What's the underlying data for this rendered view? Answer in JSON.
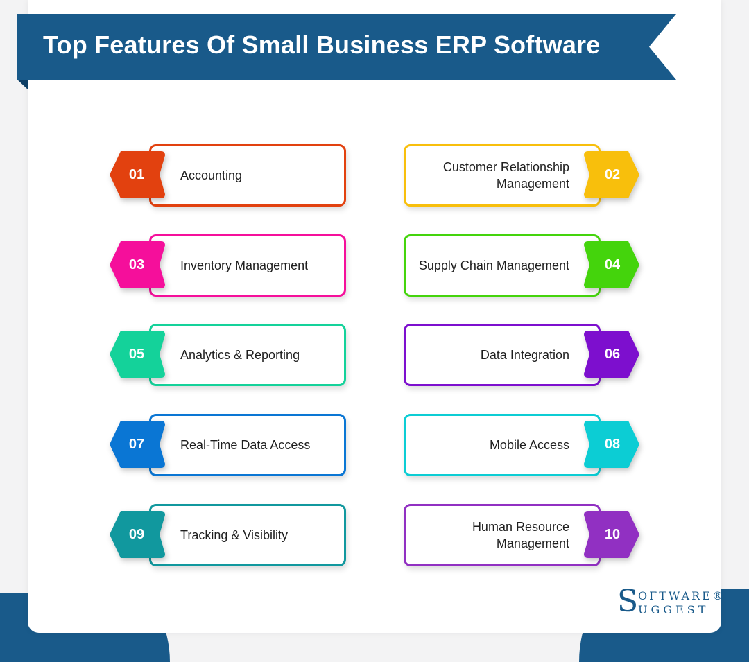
{
  "title": "Top Features Of Small Business ERP Software",
  "brand": {
    "primary_color": "#195a8a",
    "logo_initial": "S",
    "logo_top": "OFTWARE®",
    "logo_bottom": "UGGEST"
  },
  "features": [
    {
      "number": "01",
      "label": "Accounting",
      "color": "#e2410f",
      "side": "left"
    },
    {
      "number": "02",
      "label": "Customer Relationship Management",
      "color": "#f8bf0c",
      "side": "right"
    },
    {
      "number": "03",
      "label": "Inventory Management",
      "color": "#f50f9b",
      "side": "left"
    },
    {
      "number": "04",
      "label": "Supply Chain Management",
      "color": "#44d40c",
      "side": "right"
    },
    {
      "number": "05",
      "label": "Analytics & Reporting",
      "color": "#14d29a",
      "side": "left"
    },
    {
      "number": "06",
      "label": "Data Integration",
      "color": "#7d0fce",
      "side": "right"
    },
    {
      "number": "07",
      "label": "Real-Time Data Access",
      "color": "#0a76d4",
      "side": "left"
    },
    {
      "number": "08",
      "label": "Mobile Access",
      "color": "#0ccdd4",
      "side": "right"
    },
    {
      "number": "09",
      "label": "Tracking & Visibility",
      "color": "#11989e",
      "side": "left"
    },
    {
      "number": "10",
      "label": "Human Resource Management",
      "color": "#9130c2",
      "side": "right"
    }
  ]
}
